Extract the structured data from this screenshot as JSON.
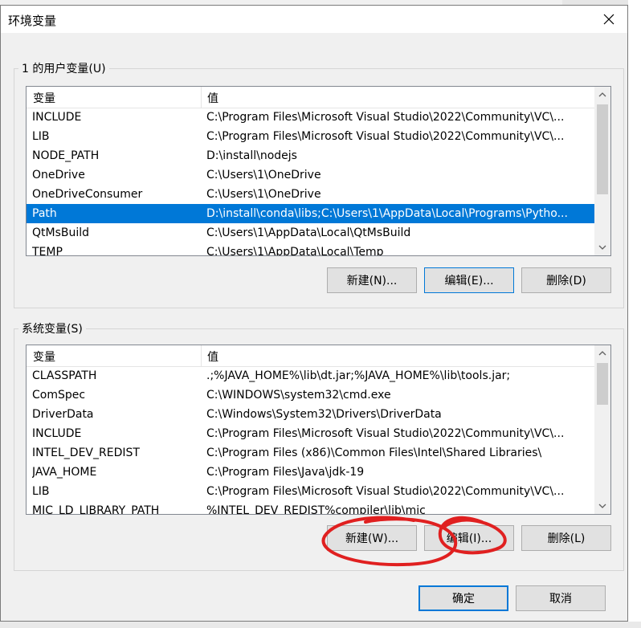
{
  "window": {
    "title": "环境变量"
  },
  "user_vars": {
    "group_label": "1 的用户变量(U)",
    "headers": [
      "变量",
      "值"
    ],
    "rows": [
      {
        "name": "INCLUDE",
        "value": "C:\\Program Files\\Microsoft Visual Studio\\2022\\Community\\VC\\..."
      },
      {
        "name": "LIB",
        "value": "C:\\Program Files\\Microsoft Visual Studio\\2022\\Community\\VC\\..."
      },
      {
        "name": "NODE_PATH",
        "value": "D:\\install\\nodejs"
      },
      {
        "name": "OneDrive",
        "value": "C:\\Users\\1\\OneDrive"
      },
      {
        "name": "OneDriveConsumer",
        "value": "C:\\Users\\1\\OneDrive"
      },
      {
        "name": "Path",
        "value": "D:\\install\\conda\\libs;C:\\Users\\1\\AppData\\Local\\Programs\\Pytho..."
      },
      {
        "name": "QtMsBuild",
        "value": "C:\\Users\\1\\AppData\\Local\\QtMsBuild"
      },
      {
        "name": "TEMP",
        "value": "C:\\Users\\1\\AppData\\Local\\Temp"
      }
    ],
    "selected_index": 5,
    "buttons": {
      "new": "新建(N)...",
      "edit": "编辑(E)...",
      "delete": "删除(D)"
    }
  },
  "system_vars": {
    "group_label": "系统变量(S)",
    "headers": [
      "变量",
      "值"
    ],
    "rows": [
      {
        "name": "CLASSPATH",
        "value": ".;%JAVA_HOME%\\lib\\dt.jar;%JAVA_HOME%\\lib\\tools.jar;"
      },
      {
        "name": "ComSpec",
        "value": "C:\\WINDOWS\\system32\\cmd.exe"
      },
      {
        "name": "DriverData",
        "value": "C:\\Windows\\System32\\Drivers\\DriverData"
      },
      {
        "name": "INCLUDE",
        "value": "C:\\Program Files\\Microsoft Visual Studio\\2022\\Community\\VC\\..."
      },
      {
        "name": "INTEL_DEV_REDIST",
        "value": "C:\\Program Files (x86)\\Common Files\\Intel\\Shared Libraries\\"
      },
      {
        "name": "JAVA_HOME",
        "value": "C:\\Program Files\\Java\\jdk-19"
      },
      {
        "name": "LIB",
        "value": "C:\\Program Files\\Microsoft Visual Studio\\2022\\Community\\VC\\..."
      },
      {
        "name": "MIC_LD_LIBRARY_PATH",
        "value": "%INTEL_DEV_REDIST%compiler\\lib\\mic"
      }
    ],
    "buttons": {
      "new": "新建(W)...",
      "edit": "编辑(I)...",
      "delete": "删除(L)"
    }
  },
  "footer": {
    "ok": "确定",
    "cancel": "取消"
  },
  "colors": {
    "selection": "#0078d7",
    "annotation": "#e02020"
  }
}
